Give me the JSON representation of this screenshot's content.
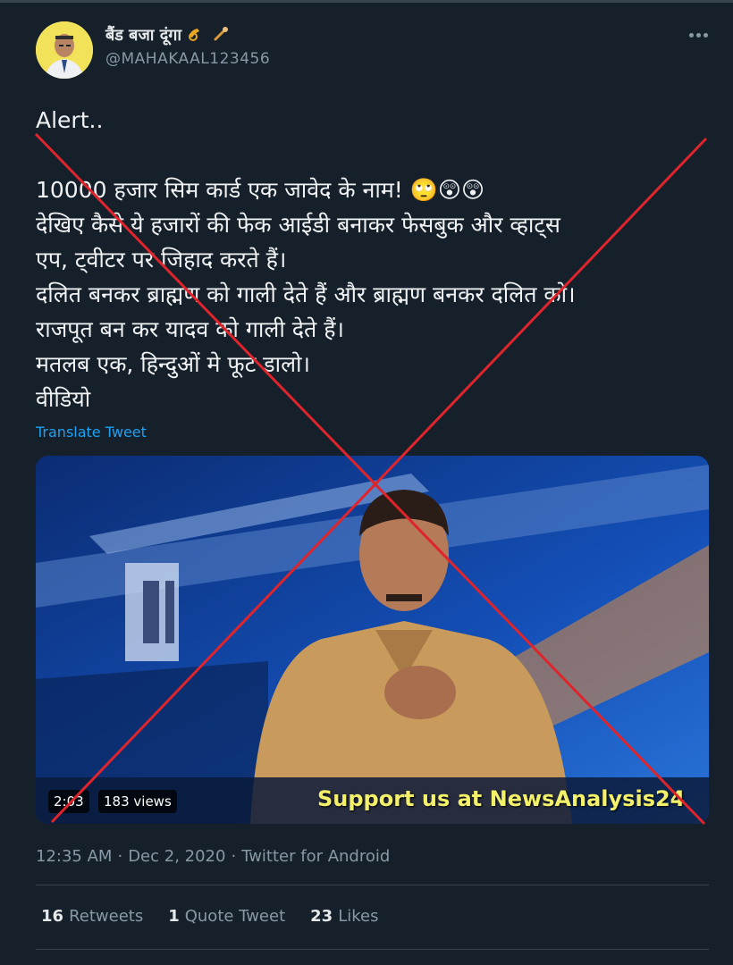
{
  "header": {
    "display_name": "बैंड बजा दूंगा",
    "handle": "@MAHAKAAL123456"
  },
  "tweet": {
    "line1": "Alert..",
    "line2": "10000 हजार सिम कार्ड एक जावेद के नाम! 🙄😲😲",
    "line3": "देखिए कैसे ये हजारों की फेक आईडी बनाकर फेसबुक और व्हाट्स",
    "line4": "एप, ट्वीटर पर जिहाद करते हैं।",
    "line5": "दलित बनकर ब्राह्मण को गाली देते हैं और ब्राह्मण बनकर दलित को।",
    "line6": "राजपूत बन कर यादव को गाली देते हैं।",
    "line7": "मतलब एक, हिन्दुओं मे फूट डालो।",
    "line8": "वीडियो",
    "translate_label": "Translate Tweet"
  },
  "media": {
    "duration": "2:03",
    "views": "183 views",
    "ticker": "Support us at NewsAnalysis24"
  },
  "meta": {
    "time": "12:35 AM",
    "date": "Dec 2, 2020",
    "source": "Twitter for Android"
  },
  "stats": {
    "retweets_count": "16",
    "retweets_label": "Retweets",
    "quotes_count": "1",
    "quotes_label": "Quote Tweet",
    "likes_count": "23",
    "likes_label": "Likes"
  },
  "colors": {
    "background": "#15202b",
    "link": "#1da1f2",
    "muted": "#8899a6",
    "cross": "#e0242c"
  },
  "icons": {
    "more": "more-horizontal-icon",
    "avatar": "profile-avatar",
    "overlay": "red-cross-mark"
  }
}
